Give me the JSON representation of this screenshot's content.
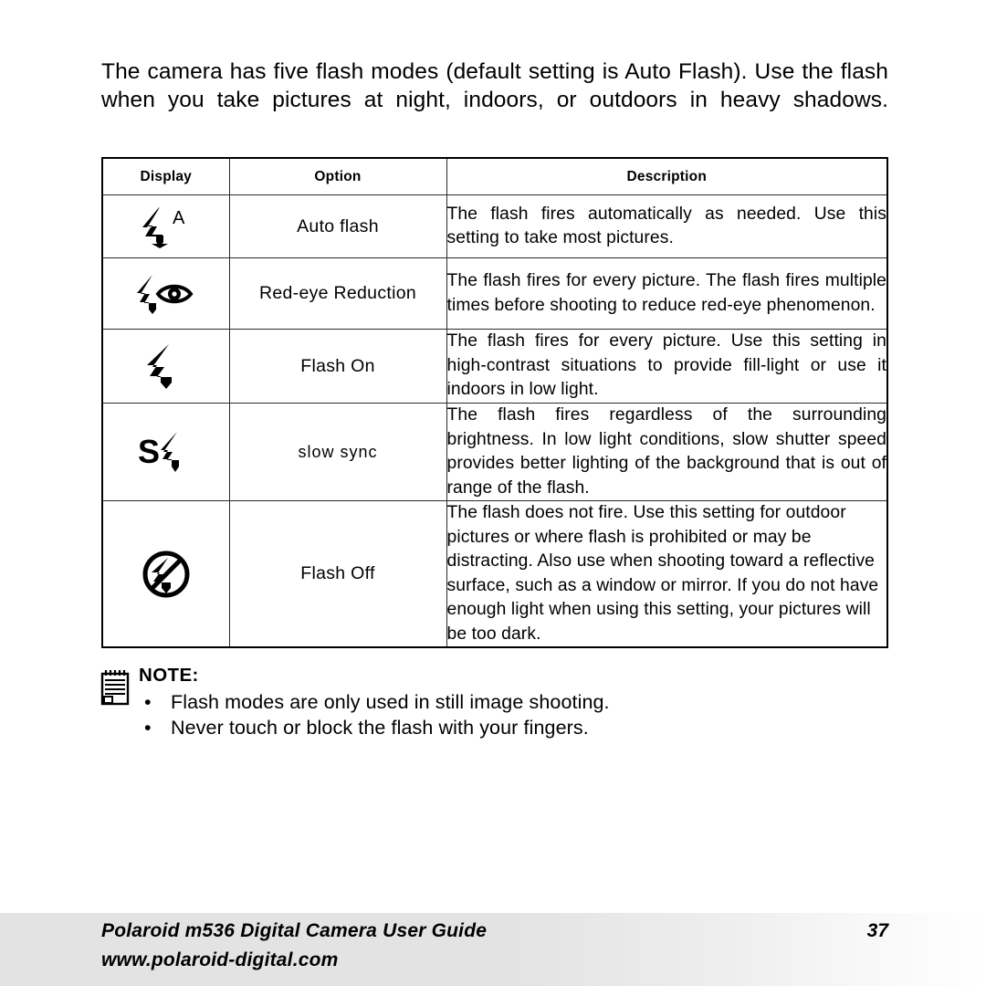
{
  "page": {
    "intro_paragraph": "The camera has five flash modes (default setting is Auto Flash). Use the flash when you take pictures at night, indoors, or outdoors in heavy shadows."
  },
  "table": {
    "headers": {
      "display": "Display",
      "option": "Option",
      "description": "Description"
    },
    "rows": [
      {
        "icon": "flash-auto-icon",
        "option": "Auto flash",
        "description": "The flash fires automatically as needed. Use this setting to take most pictures."
      },
      {
        "icon": "flash-redeye-icon",
        "option": "Red-eye Reduction",
        "description": "The flash fires for every picture. The flash fires multiple times before shooting to reduce red-eye phenomenon."
      },
      {
        "icon": "flash-on-icon",
        "option": "Flash On",
        "description": "The flash fires for every picture. Use this setting in high-contrast situations to provide fill-light or use it indoors in low light."
      },
      {
        "icon": "flash-slow-sync-icon",
        "option": "slow sync",
        "description": "The flash fires regardless of the surrounding brightness. In low light conditions, slow shutter speed provides better lighting of the background that is out of range of the flash."
      },
      {
        "icon": "flash-off-icon",
        "option": "Flash Off",
        "description": "The flash does not fire. Use this setting for outdoor pictures or where flash is prohibited or may be distracting. Also use when shooting toward a reflective surface, such as a window or mirror. If you do not have enough light when using this setting, your pictures will be too dark."
      }
    ]
  },
  "note": {
    "icon": "notepad-icon",
    "title": "NOTE:",
    "bullet_glyph": "•",
    "items": [
      "Flash modes are only used in still image shooting.",
      "Never touch or block the flash with your fingers."
    ]
  },
  "footer": {
    "guide_title": "Polaroid m536 Digital Camera User Guide",
    "website": "www.polaroid-digital.com",
    "page_number": "37"
  },
  "colors": {
    "text": "#000000",
    "page_background": "#ffffff",
    "table_border": "#000000",
    "footer_band": "#e3e3e3"
  }
}
